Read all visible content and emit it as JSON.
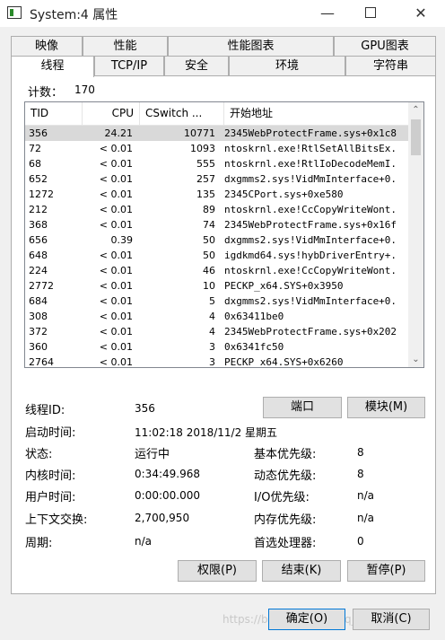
{
  "window": {
    "title": "System:4 属性",
    "minimize": "—",
    "close": "✕"
  },
  "tabs_back": [
    "映像",
    "性能",
    "性能图表",
    "GPU图表"
  ],
  "tabs_front": [
    "线程",
    "TCP/IP",
    "安全",
    "环境",
    "字符串"
  ],
  "active_tab": "线程",
  "count": {
    "label": "计数：",
    "value": "170"
  },
  "thread_list": {
    "columns": [
      "TID",
      "CPU",
      "CSwitch ...",
      "开始地址"
    ],
    "sort_indicator": "^",
    "rows": [
      {
        "tid": "356",
        "cpu": "24.21",
        "cswitch": "10771",
        "addr": "2345WebProtectFrame.sys+0x1c8",
        "selected": true
      },
      {
        "tid": "72",
        "cpu": "< 0.01",
        "cswitch": "1093",
        "addr": "ntoskrnl.exe!RtlSetAllBitsEx."
      },
      {
        "tid": "68",
        "cpu": "< 0.01",
        "cswitch": "555",
        "addr": "ntoskrnl.exe!RtlIoDecodeMemI."
      },
      {
        "tid": "652",
        "cpu": "< 0.01",
        "cswitch": "257",
        "addr": "dxgmms2.sys!VidMmInterface+0."
      },
      {
        "tid": "1272",
        "cpu": "< 0.01",
        "cswitch": "135",
        "addr": "2345CPort.sys+0xe580"
      },
      {
        "tid": "212",
        "cpu": "< 0.01",
        "cswitch": "89",
        "addr": "ntoskrnl.exe!CcCopyWriteWont."
      },
      {
        "tid": "368",
        "cpu": "< 0.01",
        "cswitch": "74",
        "addr": "2345WebProtectFrame.sys+0x16f"
      },
      {
        "tid": "656",
        "cpu": "0.39",
        "cswitch": "50",
        "addr": "dxgmms2.sys!VidMmInterface+0."
      },
      {
        "tid": "648",
        "cpu": "< 0.01",
        "cswitch": "50",
        "addr": "igdkmd64.sys!hybDriverEntry+."
      },
      {
        "tid": "224",
        "cpu": "< 0.01",
        "cswitch": "46",
        "addr": "ntoskrnl.exe!CcCopyWriteWont."
      },
      {
        "tid": "2772",
        "cpu": "< 0.01",
        "cswitch": "10",
        "addr": "PECKP_x64.SYS+0x3950"
      },
      {
        "tid": "684",
        "cpu": "< 0.01",
        "cswitch": "5",
        "addr": "dxgmms2.sys!VidMmInterface+0."
      },
      {
        "tid": "308",
        "cpu": "< 0.01",
        "cswitch": "4",
        "addr": "0x63411be0"
      },
      {
        "tid": "372",
        "cpu": "< 0.01",
        "cswitch": "4",
        "addr": "2345WebProtectFrame.sys+0x202"
      },
      {
        "tid": "360",
        "cpu": "< 0.01",
        "cswitch": "3",
        "addr": "0x6341fc50"
      },
      {
        "tid": "2764",
        "cpu": "< 0.01",
        "cswitch": "3",
        "addr": "PECKP_x64.SYS+0x6260"
      }
    ]
  },
  "details": {
    "thread_id_label": "线程ID:",
    "thread_id": "356",
    "start_time_label": "启动时间:",
    "start_time": "11:02:18  2018/11/2 星期五",
    "state_label": "状态:",
    "state": "运行中",
    "kernel_time_label": "内核时间:",
    "kernel_time": "0:34:49.968",
    "user_time_label": "用户时间:",
    "user_time": "0:00:00.000",
    "context_switch_label": "上下文交换:",
    "context_switch": "2,700,950",
    "cycles_label": "周期:",
    "cycles": "n/a",
    "base_priority_label": "基本优先级:",
    "base_priority": "8",
    "dynamic_priority_label": "动态优先级:",
    "dynamic_priority": "8",
    "io_priority_label": "I/O优先级:",
    "io_priority": "n/a",
    "memory_priority_label": "内存优先级:",
    "memory_priority": "n/a",
    "ideal_processor_label": "首选处理器:",
    "ideal_processor": "0"
  },
  "buttons": {
    "port": "端口",
    "module": "模块(M)",
    "permissions": "权限(P)",
    "end": "结束(K)",
    "pause": "暂停(P)",
    "ok": "确定(O)",
    "cancel": "取消(C)"
  },
  "watermark": "https://blog.csdn.net/qq_4...27"
}
